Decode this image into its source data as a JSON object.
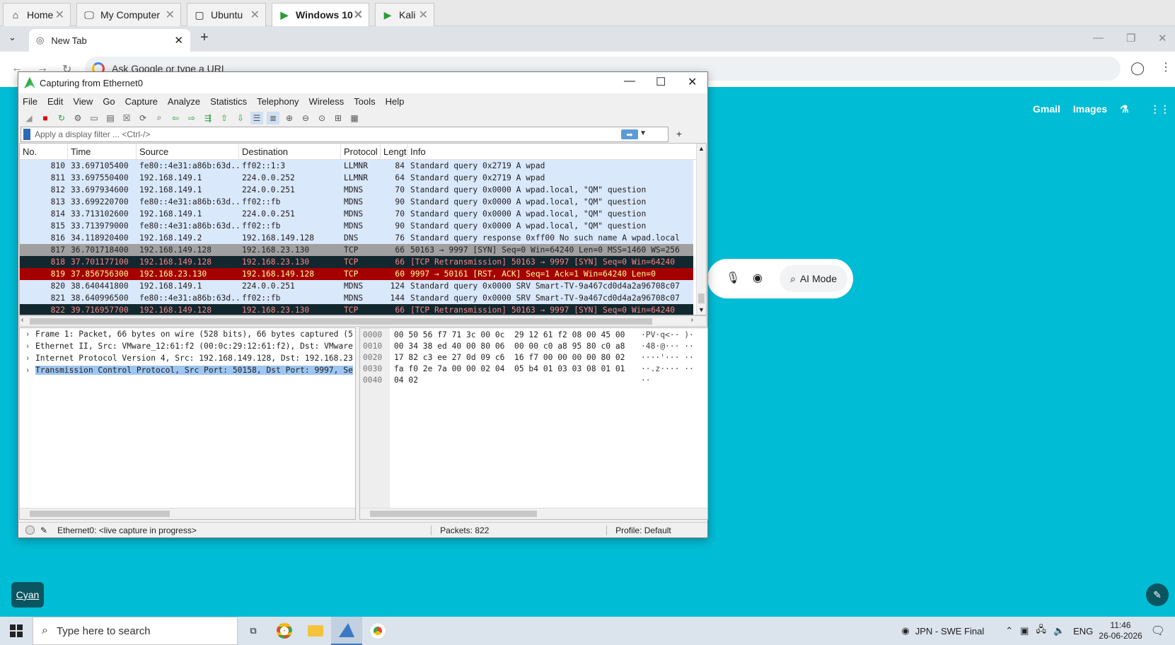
{
  "vm_tabs": [
    {
      "label": "Home",
      "icon": "home-icon"
    },
    {
      "label": "My Computer",
      "icon": "computer-icon"
    },
    {
      "label": "Ubuntu",
      "icon": "vm-icon"
    },
    {
      "label": "Windows 10",
      "icon": "vm-running-icon"
    },
    {
      "label": "Kali",
      "icon": "vm-running-icon"
    }
  ],
  "browser": {
    "tab_title": "New Tab",
    "omnibox_placeholder": "Ask Google or type a URL",
    "links": {
      "gmail": "Gmail",
      "images": "Images"
    },
    "ai_mode": "AI Mode",
    "profile_button": "Cyan"
  },
  "wireshark": {
    "title": "Capturing from Ethernet0",
    "menu": [
      "File",
      "Edit",
      "View",
      "Go",
      "Capture",
      "Analyze",
      "Statistics",
      "Telephony",
      "Wireless",
      "Tools",
      "Help"
    ],
    "filter_placeholder": "Apply a display filter ... <Ctrl-/>",
    "columns": [
      "No.",
      "Time",
      "Source",
      "Destination",
      "Protocol",
      "Length",
      "Info"
    ],
    "packets": [
      {
        "no": "810",
        "time": "33.697105400",
        "src": "fe80::4e31:a86b:63d...",
        "dst": "ff02::1:3",
        "proto": "LLMNR",
        "len": "84",
        "info": "Standard query 0x2719 A wpad",
        "style": "blue"
      },
      {
        "no": "811",
        "time": "33.697550400",
        "src": "192.168.149.1",
        "dst": "224.0.0.252",
        "proto": "LLMNR",
        "len": "64",
        "info": "Standard query 0x2719 A wpad",
        "style": "blue"
      },
      {
        "no": "812",
        "time": "33.697934600",
        "src": "192.168.149.1",
        "dst": "224.0.0.251",
        "proto": "MDNS",
        "len": "70",
        "info": "Standard query 0x0000 A wpad.local, \"QM\" question",
        "style": "blue"
      },
      {
        "no": "813",
        "time": "33.699220700",
        "src": "fe80::4e31:a86b:63d...",
        "dst": "ff02::fb",
        "proto": "MDNS",
        "len": "90",
        "info": "Standard query 0x0000 A wpad.local, \"QM\" question",
        "style": "blue"
      },
      {
        "no": "814",
        "time": "33.713102600",
        "src": "192.168.149.1",
        "dst": "224.0.0.251",
        "proto": "MDNS",
        "len": "70",
        "info": "Standard query 0x0000 A wpad.local, \"QM\" question",
        "style": "blue"
      },
      {
        "no": "815",
        "time": "33.713979000",
        "src": "fe80::4e31:a86b:63d...",
        "dst": "ff02::fb",
        "proto": "MDNS",
        "len": "90",
        "info": "Standard query 0x0000 A wpad.local, \"QM\" question",
        "style": "blue"
      },
      {
        "no": "816",
        "time": "34.118920400",
        "src": "192.168.149.2",
        "dst": "192.168.149.128",
        "proto": "DNS",
        "len": "76",
        "info": "Standard query response 0xff00 No such name A wpad.local",
        "style": "blue"
      },
      {
        "no": "817",
        "time": "36.701718400",
        "src": "192.168.149.128",
        "dst": "192.168.23.130",
        "proto": "TCP",
        "len": "66",
        "info": "50163 → 9997 [SYN] Seq=0 Win=64240 Len=0 MSS=1460 WS=256",
        "style": "grey"
      },
      {
        "no": "818",
        "time": "37.701177100",
        "src": "192.168.149.128",
        "dst": "192.168.23.130",
        "proto": "TCP",
        "len": "66",
        "info": "[TCP Retransmission] 50163 → 9997 [SYN] Seq=0 Win=64240",
        "style": "black"
      },
      {
        "no": "819",
        "time": "37.856756300",
        "src": "192.168.23.130",
        "dst": "192.168.149.128",
        "proto": "TCP",
        "len": "60",
        "info": "9997 → 50161 [RST, ACK] Seq=1 Ack=1 Win=64240 Len=0",
        "style": "red"
      },
      {
        "no": "820",
        "time": "38.640441800",
        "src": "192.168.149.1",
        "dst": "224.0.0.251",
        "proto": "MDNS",
        "len": "124",
        "info": "Standard query 0x0000 SRV Smart-TV-9a467cd0d4a2a96708c07",
        "style": "blue"
      },
      {
        "no": "821",
        "time": "38.640996500",
        "src": "fe80::4e31:a86b:63d...",
        "dst": "ff02::fb",
        "proto": "MDNS",
        "len": "144",
        "info": "Standard query 0x0000 SRV Smart-TV-9a467cd0d4a2a96708c07",
        "style": "blue"
      },
      {
        "no": "822",
        "time": "39.716957700",
        "src": "192.168.149.128",
        "dst": "192.168.23.130",
        "proto": "TCP",
        "len": "66",
        "info": "[TCP Retransmission] 50163 → 9997 [SYN] Seq=0 Win=64240",
        "style": "black"
      }
    ],
    "details": [
      {
        "text": "Frame 1: Packet, 66 bytes on wire (528 bits), 66 bytes captured (5",
        "selected": false
      },
      {
        "text": "Ethernet II, Src: VMware_12:61:f2 (00:0c:29:12:61:f2), Dst: VMware",
        "selected": false
      },
      {
        "text": "Internet Protocol Version 4, Src: 192.168.149.128, Dst: 192.168.23",
        "selected": false
      },
      {
        "text": "Transmission Control Protocol, Src Port: 50158, Dst Port: 9997, Se",
        "selected": true
      }
    ],
    "hex": [
      {
        "off": "0000",
        "bytes": "00 50 56 f7 71 3c 00 0c  29 12 61 f2 08 00 45 00",
        "ascii": "·PV·q<·· )·"
      },
      {
        "off": "0010",
        "bytes": "00 34 38 ed 40 00 80 06  00 00 c0 a8 95 80 c0 a8",
        "ascii": "·48·@··· ··"
      },
      {
        "off": "0020",
        "bytes": "17 82 c3 ee 27 0d 09 c6  16 f7 00 00 00 00 80 02",
        "ascii": "····'··· ··"
      },
      {
        "off": "0030",
        "bytes": "fa f0 2e 7a 00 00 02 04  05 b4 01 03 03 08 01 01",
        "ascii": "··.z···· ··"
      },
      {
        "off": "0040",
        "bytes": "04 02",
        "ascii": "··"
      }
    ],
    "status": {
      "capture": "Ethernet0: <live capture in progress>",
      "packets": "Packets: 822",
      "profile": "Profile: Default"
    }
  },
  "taskbar": {
    "search_placeholder": "Type here to search",
    "network": "JPN - SWE Final",
    "lang": "ENG",
    "time": "11:46",
    "date": "26-06-2026"
  },
  "colors": {
    "page_bg": "#00bcd4",
    "packet_blue": "#dae8fc",
    "packet_red": "#a40000",
    "packet_black": "#12272e"
  }
}
